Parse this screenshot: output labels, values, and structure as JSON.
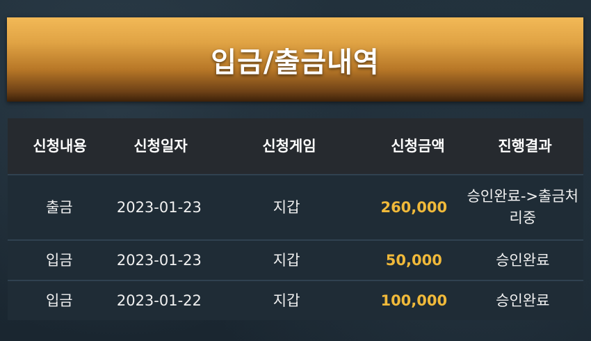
{
  "page": {
    "title": "입금/출금내역",
    "accent_color": "#f0b93a",
    "banner_gradient": [
      "#f2b957",
      "#b77727",
      "#3c2109"
    ]
  },
  "table": {
    "headers": [
      "신청내용",
      "신청일자",
      "신청게임",
      "신청금액",
      "진행결과"
    ],
    "rows": [
      {
        "type": "출금",
        "date": "2023-01-23",
        "game": "지갑",
        "amount": "260,000",
        "result": "승인완료->출금처리중"
      },
      {
        "type": "입금",
        "date": "2023-01-23",
        "game": "지갑",
        "amount": "50,000",
        "result": "승인완료"
      },
      {
        "type": "입금",
        "date": "2023-01-22",
        "game": "지갑",
        "amount": "100,000",
        "result": "승인완료"
      }
    ]
  }
}
